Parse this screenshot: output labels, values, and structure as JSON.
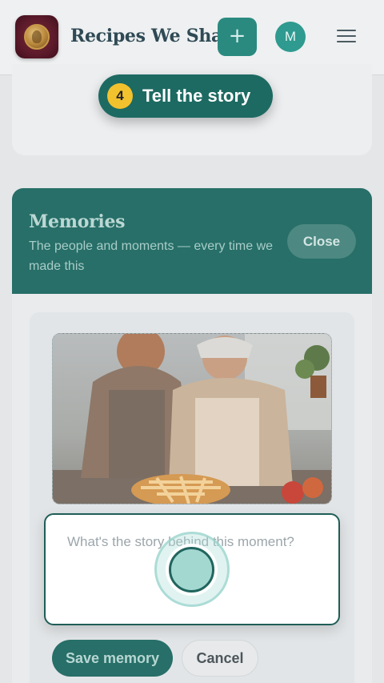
{
  "header": {
    "app_title": "Recipes We Share",
    "add_label": "+",
    "avatar_initial": "M",
    "logo_icon": "tree-medallion-icon",
    "menu_icon": "hamburger-menu-icon"
  },
  "step": {
    "number": "4",
    "label": "Tell the story"
  },
  "memories": {
    "title": "Memories",
    "subtitle": "The people and moments — every time we made this",
    "close_label": "Close",
    "story_placeholder": "What's the story behind this moment?",
    "save_label": "Save memory",
    "cancel_label": "Cancel"
  },
  "colors": {
    "accent": "#276f68",
    "step_badge": "#1d6a62",
    "step_number": "#f2c12e",
    "avatar": "#2f9a8f"
  }
}
